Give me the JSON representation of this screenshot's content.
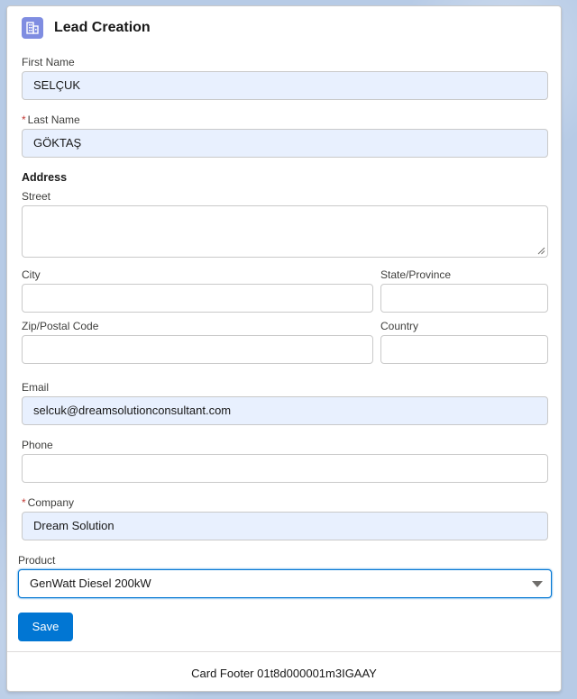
{
  "card": {
    "title": "Lead Creation",
    "icon": "lead-icon",
    "footer": "Card Footer 01t8d000001m3IGAAY"
  },
  "colors": {
    "accent": "#0176d3",
    "header_icon_bg": "#7f8de1",
    "required": "#c23934",
    "autofill_bg": "#e8f0fe"
  },
  "form": {
    "first_name": {
      "label": "First Name",
      "value": "SELÇUK"
    },
    "last_name": {
      "label": "Last Name",
      "value": "GÖKTAŞ",
      "required_mark": "*"
    },
    "address": {
      "section_title": "Address",
      "street": {
        "label": "Street",
        "value": ""
      },
      "city": {
        "label": "City",
        "value": ""
      },
      "state": {
        "label": "State/Province",
        "value": ""
      },
      "zip": {
        "label": "Zip/Postal Code",
        "value": ""
      },
      "country": {
        "label": "Country",
        "value": ""
      }
    },
    "email": {
      "label": "Email",
      "value": "selcuk@dreamsolutionconsultant.com"
    },
    "phone": {
      "label": "Phone",
      "value": ""
    },
    "company": {
      "label": "Company",
      "value": "Dream Solution",
      "required_mark": "*"
    },
    "product": {
      "label": "Product",
      "selected": "GenWatt Diesel 200kW"
    },
    "save_label": "Save"
  }
}
